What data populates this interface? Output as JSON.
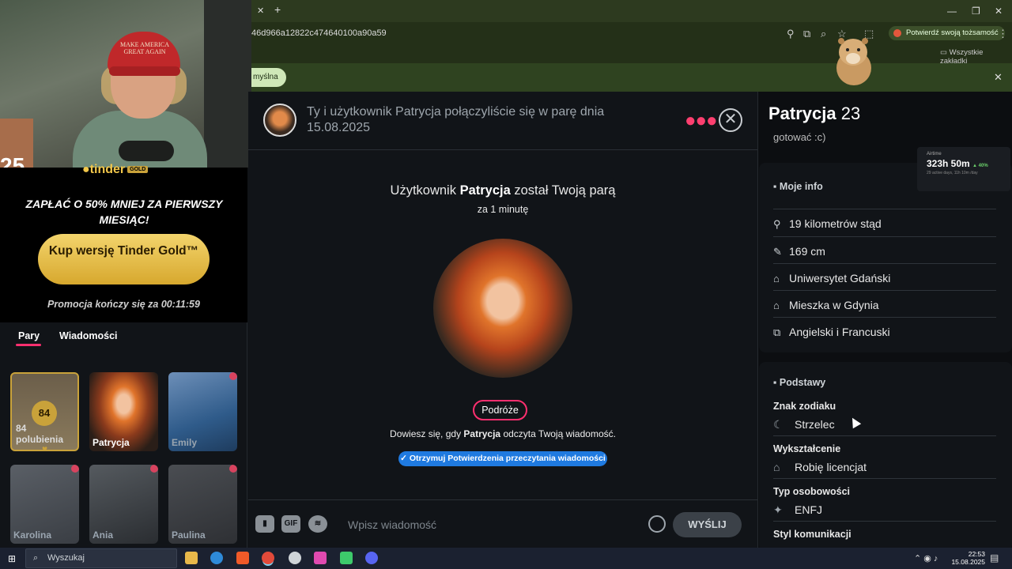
{
  "browser": {
    "new_tab": "+",
    "url": "46d966a12822c474640100a90a59",
    "verify_label": "Potwierdź swoją tożsamość",
    "bookmarks_label": "Wszystkie zakładki",
    "info_pill": "myślna",
    "win_min": "—",
    "win_max": "❐",
    "win_close": "✕"
  },
  "webcam": {
    "cap_text": "MAKE AMERICA GREAT AGAIN",
    "overlay_number": "25"
  },
  "promo": {
    "brand": "tinder",
    "badge": "GOLD",
    "title": "ZAPŁAĆ O 50% MNIEJ ZA PIERWSZY MIESIĄC!",
    "buy_button": "Kup wersję Tinder Gold™",
    "ends": "Promocja kończy się za 00:11:59"
  },
  "tabs": {
    "matches": "Pary",
    "messages": "Wiadomości"
  },
  "matches": [
    {
      "name": "84 polubienia",
      "count": "84"
    },
    {
      "name": "Patrycja"
    },
    {
      "name": "Emily"
    },
    {
      "name": "Karolina"
    },
    {
      "name": "Ania"
    },
    {
      "name": "Paulina"
    }
  ],
  "chat": {
    "header": "Ty i użytkownik Patrycja połączyliście się w parę dnia 15.08.2025",
    "matched_prefix": "Użytkownik ",
    "matched_name": "Patrycja",
    "matched_suffix": " został Twoją parą",
    "ago": "za 1 minutę",
    "interest": "Podróże",
    "read_prefix": "Dowiesz się, gdy ",
    "read_name": "Patrycja",
    "read_suffix": " odczyta Twoją wiadomość.",
    "read_button": "✓ Otrzymuj Potwierdzenia przeczytania wiadomości",
    "gif_label": "GIF",
    "input_placeholder": "Wpisz wiadomość",
    "send": "WYŚLIJ"
  },
  "profile": {
    "name": "Patrycja",
    "age": "23",
    "truncated": "gotować :c)",
    "info_title": "Moje info",
    "info": [
      {
        "icon": "pin-icon",
        "text": "19 kilometrów stąd"
      },
      {
        "icon": "ruler-icon",
        "text": "169 cm"
      },
      {
        "icon": "graduation-cap-icon",
        "text": "Uniwersytet Gdański"
      },
      {
        "icon": "home-icon",
        "text": "Mieszka w Gdynia"
      },
      {
        "icon": "language-icon",
        "text": "Angielski i Francuski"
      }
    ],
    "basics_title": "Podstawy",
    "basics": [
      {
        "label": "Znak zodiaku",
        "value": "Strzelec",
        "icon": "moon-icon"
      },
      {
        "label": "Wykształcenie",
        "value": "Robię licencjat",
        "icon": "graduation-cap-icon"
      },
      {
        "label": "Typ osobowości",
        "value": "ENFJ",
        "icon": "puzzle-icon"
      },
      {
        "label": "Styl komunikacji",
        "value": "",
        "icon": "chat-icon"
      }
    ]
  },
  "airtime": {
    "title": "Airtime",
    "value": "323h 50m",
    "growth": "▲ 40%",
    "sub": "29 active days, 11h 10m /day"
  },
  "taskbar": {
    "search": "Wyszukaj",
    "time": "22:53",
    "date": "15.08.2025"
  }
}
